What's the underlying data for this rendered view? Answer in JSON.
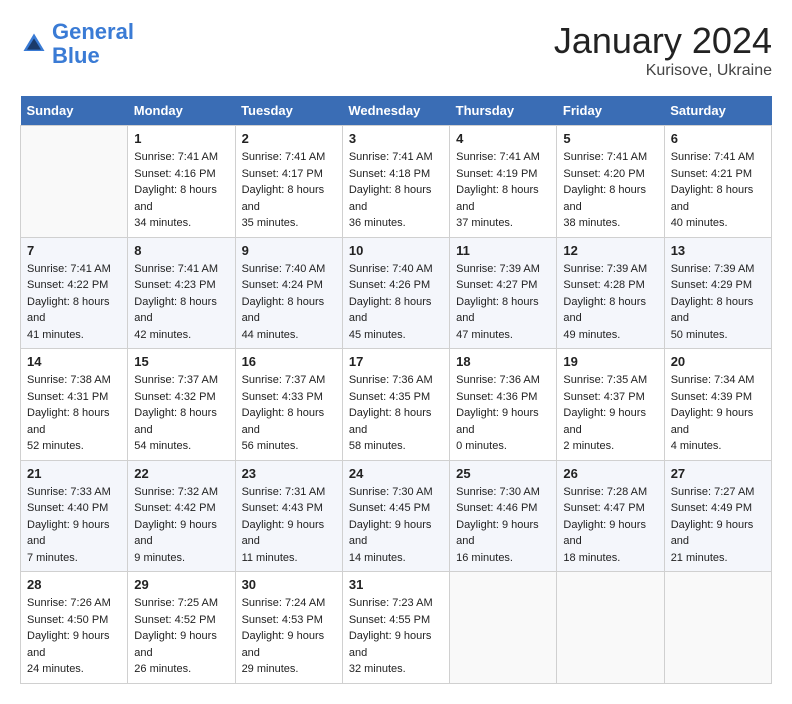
{
  "app": {
    "logo_line1": "General",
    "logo_line2": "Blue"
  },
  "title": {
    "month_year": "January 2024",
    "location": "Kurisove, Ukraine"
  },
  "weekdays": [
    "Sunday",
    "Monday",
    "Tuesday",
    "Wednesday",
    "Thursday",
    "Friday",
    "Saturday"
  ],
  "weeks": [
    [
      {
        "day": "",
        "sunrise": "",
        "sunset": "",
        "daylight": ""
      },
      {
        "day": "1",
        "sunrise": "Sunrise: 7:41 AM",
        "sunset": "Sunset: 4:16 PM",
        "daylight": "Daylight: 8 hours and 34 minutes."
      },
      {
        "day": "2",
        "sunrise": "Sunrise: 7:41 AM",
        "sunset": "Sunset: 4:17 PM",
        "daylight": "Daylight: 8 hours and 35 minutes."
      },
      {
        "day": "3",
        "sunrise": "Sunrise: 7:41 AM",
        "sunset": "Sunset: 4:18 PM",
        "daylight": "Daylight: 8 hours and 36 minutes."
      },
      {
        "day": "4",
        "sunrise": "Sunrise: 7:41 AM",
        "sunset": "Sunset: 4:19 PM",
        "daylight": "Daylight: 8 hours and 37 minutes."
      },
      {
        "day": "5",
        "sunrise": "Sunrise: 7:41 AM",
        "sunset": "Sunset: 4:20 PM",
        "daylight": "Daylight: 8 hours and 38 minutes."
      },
      {
        "day": "6",
        "sunrise": "Sunrise: 7:41 AM",
        "sunset": "Sunset: 4:21 PM",
        "daylight": "Daylight: 8 hours and 40 minutes."
      }
    ],
    [
      {
        "day": "7",
        "sunrise": "Sunrise: 7:41 AM",
        "sunset": "Sunset: 4:22 PM",
        "daylight": "Daylight: 8 hours and 41 minutes."
      },
      {
        "day": "8",
        "sunrise": "Sunrise: 7:41 AM",
        "sunset": "Sunset: 4:23 PM",
        "daylight": "Daylight: 8 hours and 42 minutes."
      },
      {
        "day": "9",
        "sunrise": "Sunrise: 7:40 AM",
        "sunset": "Sunset: 4:24 PM",
        "daylight": "Daylight: 8 hours and 44 minutes."
      },
      {
        "day": "10",
        "sunrise": "Sunrise: 7:40 AM",
        "sunset": "Sunset: 4:26 PM",
        "daylight": "Daylight: 8 hours and 45 minutes."
      },
      {
        "day": "11",
        "sunrise": "Sunrise: 7:39 AM",
        "sunset": "Sunset: 4:27 PM",
        "daylight": "Daylight: 8 hours and 47 minutes."
      },
      {
        "day": "12",
        "sunrise": "Sunrise: 7:39 AM",
        "sunset": "Sunset: 4:28 PM",
        "daylight": "Daylight: 8 hours and 49 minutes."
      },
      {
        "day": "13",
        "sunrise": "Sunrise: 7:39 AM",
        "sunset": "Sunset: 4:29 PM",
        "daylight": "Daylight: 8 hours and 50 minutes."
      }
    ],
    [
      {
        "day": "14",
        "sunrise": "Sunrise: 7:38 AM",
        "sunset": "Sunset: 4:31 PM",
        "daylight": "Daylight: 8 hours and 52 minutes."
      },
      {
        "day": "15",
        "sunrise": "Sunrise: 7:37 AM",
        "sunset": "Sunset: 4:32 PM",
        "daylight": "Daylight: 8 hours and 54 minutes."
      },
      {
        "day": "16",
        "sunrise": "Sunrise: 7:37 AM",
        "sunset": "Sunset: 4:33 PM",
        "daylight": "Daylight: 8 hours and 56 minutes."
      },
      {
        "day": "17",
        "sunrise": "Sunrise: 7:36 AM",
        "sunset": "Sunset: 4:35 PM",
        "daylight": "Daylight: 8 hours and 58 minutes."
      },
      {
        "day": "18",
        "sunrise": "Sunrise: 7:36 AM",
        "sunset": "Sunset: 4:36 PM",
        "daylight": "Daylight: 9 hours and 0 minutes."
      },
      {
        "day": "19",
        "sunrise": "Sunrise: 7:35 AM",
        "sunset": "Sunset: 4:37 PM",
        "daylight": "Daylight: 9 hours and 2 minutes."
      },
      {
        "day": "20",
        "sunrise": "Sunrise: 7:34 AM",
        "sunset": "Sunset: 4:39 PM",
        "daylight": "Daylight: 9 hours and 4 minutes."
      }
    ],
    [
      {
        "day": "21",
        "sunrise": "Sunrise: 7:33 AM",
        "sunset": "Sunset: 4:40 PM",
        "daylight": "Daylight: 9 hours and 7 minutes."
      },
      {
        "day": "22",
        "sunrise": "Sunrise: 7:32 AM",
        "sunset": "Sunset: 4:42 PM",
        "daylight": "Daylight: 9 hours and 9 minutes."
      },
      {
        "day": "23",
        "sunrise": "Sunrise: 7:31 AM",
        "sunset": "Sunset: 4:43 PM",
        "daylight": "Daylight: 9 hours and 11 minutes."
      },
      {
        "day": "24",
        "sunrise": "Sunrise: 7:30 AM",
        "sunset": "Sunset: 4:45 PM",
        "daylight": "Daylight: 9 hours and 14 minutes."
      },
      {
        "day": "25",
        "sunrise": "Sunrise: 7:30 AM",
        "sunset": "Sunset: 4:46 PM",
        "daylight": "Daylight: 9 hours and 16 minutes."
      },
      {
        "day": "26",
        "sunrise": "Sunrise: 7:28 AM",
        "sunset": "Sunset: 4:47 PM",
        "daylight": "Daylight: 9 hours and 18 minutes."
      },
      {
        "day": "27",
        "sunrise": "Sunrise: 7:27 AM",
        "sunset": "Sunset: 4:49 PM",
        "daylight": "Daylight: 9 hours and 21 minutes."
      }
    ],
    [
      {
        "day": "28",
        "sunrise": "Sunrise: 7:26 AM",
        "sunset": "Sunset: 4:50 PM",
        "daylight": "Daylight: 9 hours and 24 minutes."
      },
      {
        "day": "29",
        "sunrise": "Sunrise: 7:25 AM",
        "sunset": "Sunset: 4:52 PM",
        "daylight": "Daylight: 9 hours and 26 minutes."
      },
      {
        "day": "30",
        "sunrise": "Sunrise: 7:24 AM",
        "sunset": "Sunset: 4:53 PM",
        "daylight": "Daylight: 9 hours and 29 minutes."
      },
      {
        "day": "31",
        "sunrise": "Sunrise: 7:23 AM",
        "sunset": "Sunset: 4:55 PM",
        "daylight": "Daylight: 9 hours and 32 minutes."
      },
      {
        "day": "",
        "sunrise": "",
        "sunset": "",
        "daylight": ""
      },
      {
        "day": "",
        "sunrise": "",
        "sunset": "",
        "daylight": ""
      },
      {
        "day": "",
        "sunrise": "",
        "sunset": "",
        "daylight": ""
      }
    ]
  ]
}
